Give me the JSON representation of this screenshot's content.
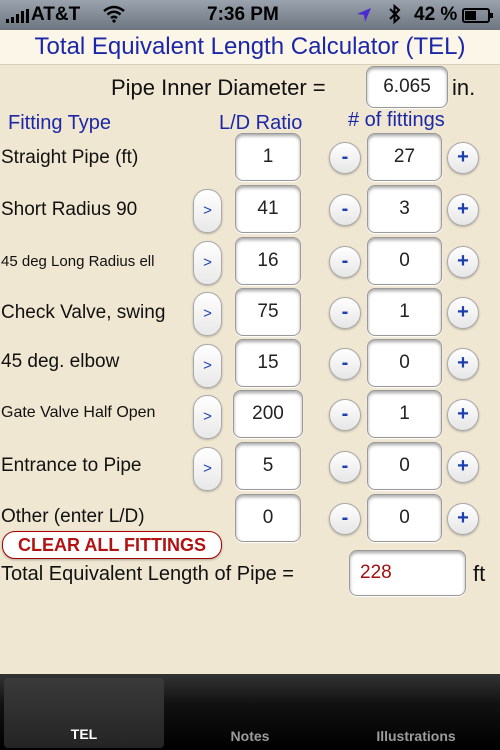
{
  "status_bar": {
    "carrier": "AT&T",
    "time": "7:36 PM",
    "battery": "42 %"
  },
  "app_title": "Total Equivalent Length Calculator (TEL)",
  "diameter": {
    "label": "Pipe Inner Diameter =",
    "value": "6.065",
    "unit": "in."
  },
  "headers": {
    "fitting_type": "Fitting Type",
    "ld_ratio": "L/D Ratio",
    "num_fittings": "# of fittings"
  },
  "buttons": {
    "chevron": ">",
    "minus": "-",
    "plus": "+",
    "clear": "CLEAR ALL FITTINGS"
  },
  "fittings": [
    {
      "name": "Straight Pipe (ft)",
      "ld": "1",
      "count": "27"
    },
    {
      "name": "Short Radius 90",
      "ld": "41",
      "count": "3"
    },
    {
      "name": "45 deg Long Radius ell",
      "ld": "16",
      "count": "0"
    },
    {
      "name": "Check Valve, swing",
      "ld": "75",
      "count": "1"
    },
    {
      "name": "45 deg. elbow",
      "ld": "15",
      "count": "0"
    },
    {
      "name": "Gate Valve Half Open",
      "ld": "200",
      "count": "1"
    },
    {
      "name": "Entrance to Pipe",
      "ld": "5",
      "count": "0"
    },
    {
      "name": "Other (enter L/D)",
      "ld": "0",
      "count": "0"
    }
  ],
  "total": {
    "label": "Total Equivalent Length of Pipe =",
    "value": "228",
    "unit": "ft",
    "value_color": "#a01010"
  },
  "tabs": [
    {
      "label": "TEL"
    },
    {
      "label": "Notes"
    },
    {
      "label": "Illustrations"
    }
  ]
}
